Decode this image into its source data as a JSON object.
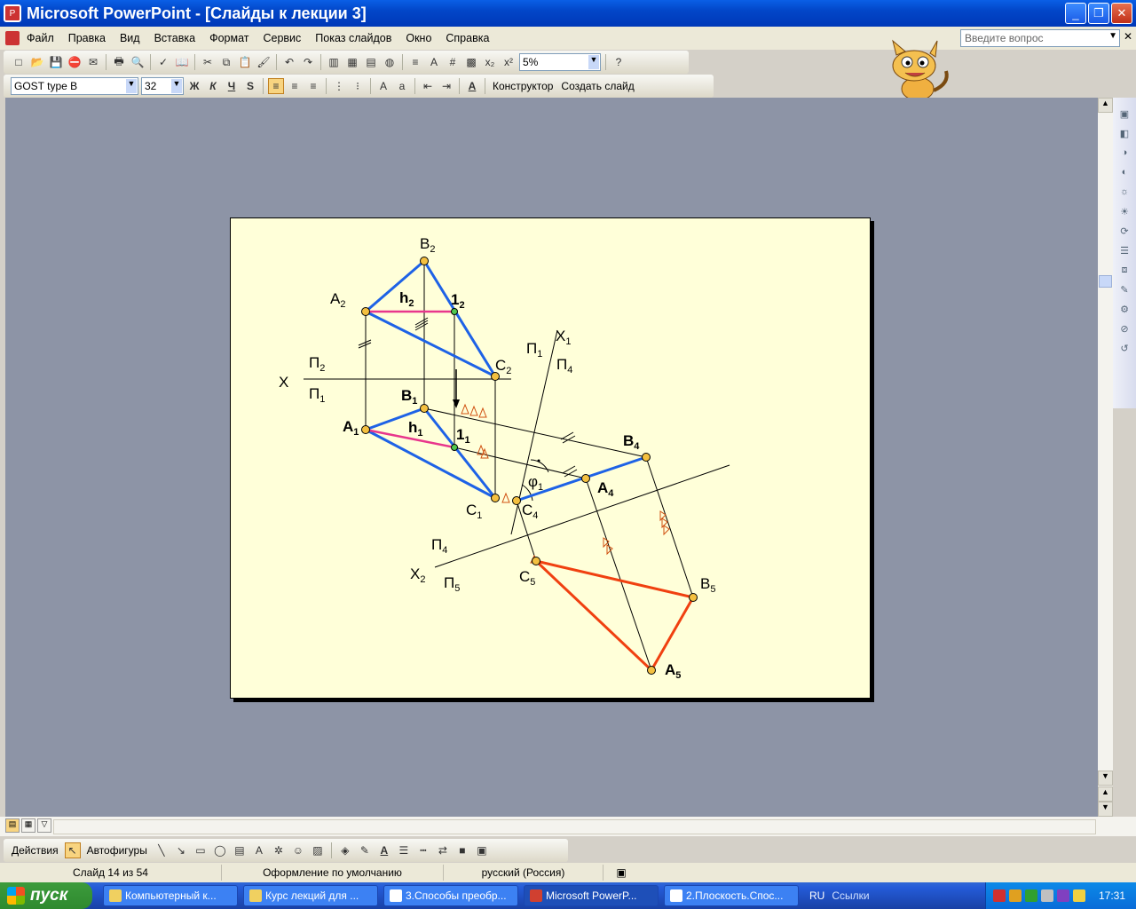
{
  "window": {
    "title": "Microsoft PowerPoint - [Слайды к лекции 3]",
    "min": "_",
    "max": "❐",
    "close": "✕"
  },
  "menu": [
    "Файл",
    "Правка",
    "Вид",
    "Вставка",
    "Формат",
    "Сервис",
    "Показ слайдов",
    "Окно",
    "Справка"
  ],
  "help_placeholder": "Введите вопрос",
  "mdi_controls": "✕",
  "toolbar": {
    "zoom": "5%",
    "font": "GOST type B",
    "size": "32",
    "bold": "Ж",
    "italic": "К",
    "underline": "Ч",
    "shadow": "S",
    "designer": "Конструктор",
    "new_slide": "Создать слайд"
  },
  "slide": {
    "labels": {
      "B2": "B",
      "B2s": "2",
      "A2": "A",
      "A2s": "2",
      "h2": "h",
      "h2s": "2",
      "i2": "1",
      "i2s": "2",
      "C2": "C",
      "C2s": "2",
      "X": "X",
      "P2": "П",
      "P2s": "2",
      "P1": "П",
      "P1s": "1",
      "B1": "B",
      "B1s": "1",
      "A1": "A",
      "A1s": "1",
      "h1": "h",
      "h1s": "1",
      "i1": "1",
      "i1s": "1",
      "C1": "C",
      "C1s": "1",
      "X1": "X",
      "X1s": "1",
      "P1b": "П",
      "P1bs": "1",
      "P4": "П",
      "P4s": "4",
      "B4": "B",
      "B4s": "4",
      "A4": "A",
      "A4s": "4",
      "C4": "C",
      "C4s": "4",
      "phi": "φ",
      "phis": "1",
      "P4b": "П",
      "P4bs": "4",
      "X2": "X",
      "X2s": "2",
      "P5": "П",
      "P5s": "5",
      "C5": "C",
      "C5s": "5",
      "B5": "B",
      "B5s": "5",
      "A5": "A",
      "A5s": "5"
    }
  },
  "drawing": {
    "actions": "Действия",
    "autoshapes": "Автофигуры"
  },
  "status": {
    "slide": "Слайд 14 из 54",
    "design": "Оформление по умолчанию",
    "lang": "русский (Россия)"
  },
  "taskbar": {
    "start": "пуск",
    "tasks": [
      "Компьютерный к...",
      "Курс лекций для ...",
      "3.Способы преобр...",
      "Microsoft PowerP...",
      "2.Плоскость.Спос..."
    ],
    "lang": "RU",
    "links": "Ссылки",
    "time": "17:31"
  }
}
